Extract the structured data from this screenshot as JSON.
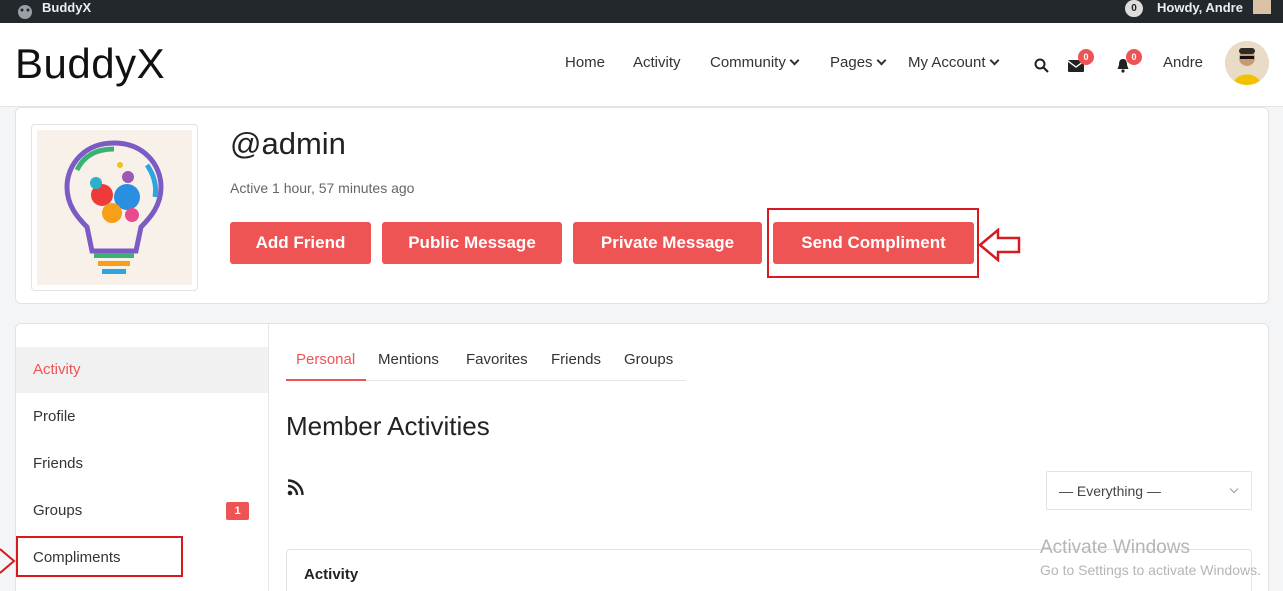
{
  "adminbar": {
    "site_name": "BuddyX",
    "notification_count": "0",
    "howdy": "Howdy, Andre"
  },
  "header": {
    "logo": "BuddyX",
    "nav": [
      {
        "label": "Home"
      },
      {
        "label": "Activity"
      },
      {
        "label": "Community"
      },
      {
        "label": "Pages"
      },
      {
        "label": "My Account"
      }
    ],
    "messages_count": "0",
    "notifications_count": "0",
    "username": "Andre"
  },
  "profile": {
    "handle": "@admin",
    "last_active": "Active 1 hour, 57 minutes ago",
    "buttons": {
      "add_friend": "Add Friend",
      "public_message": "Public Message",
      "private_message": "Private Message",
      "send_compliment": "Send Compliment"
    }
  },
  "sidebar": {
    "items": [
      {
        "label": "Activity"
      },
      {
        "label": "Profile"
      },
      {
        "label": "Friends"
      },
      {
        "label": "Groups",
        "badge": "1"
      },
      {
        "label": "Compliments"
      }
    ]
  },
  "subnav": {
    "tabs": [
      {
        "label": "Personal"
      },
      {
        "label": "Mentions"
      },
      {
        "label": "Favorites"
      },
      {
        "label": "Friends"
      },
      {
        "label": "Groups"
      }
    ]
  },
  "main": {
    "title": "Member Activities",
    "filter_value": "— Everything —",
    "activity_label": "Activity"
  },
  "watermark": {
    "line1": "Activate Windows",
    "line2": "Go to Settings to activate Windows."
  },
  "colors": {
    "accent": "#ef5455",
    "highlight": "#d71920",
    "adminbar": "#23282d"
  }
}
